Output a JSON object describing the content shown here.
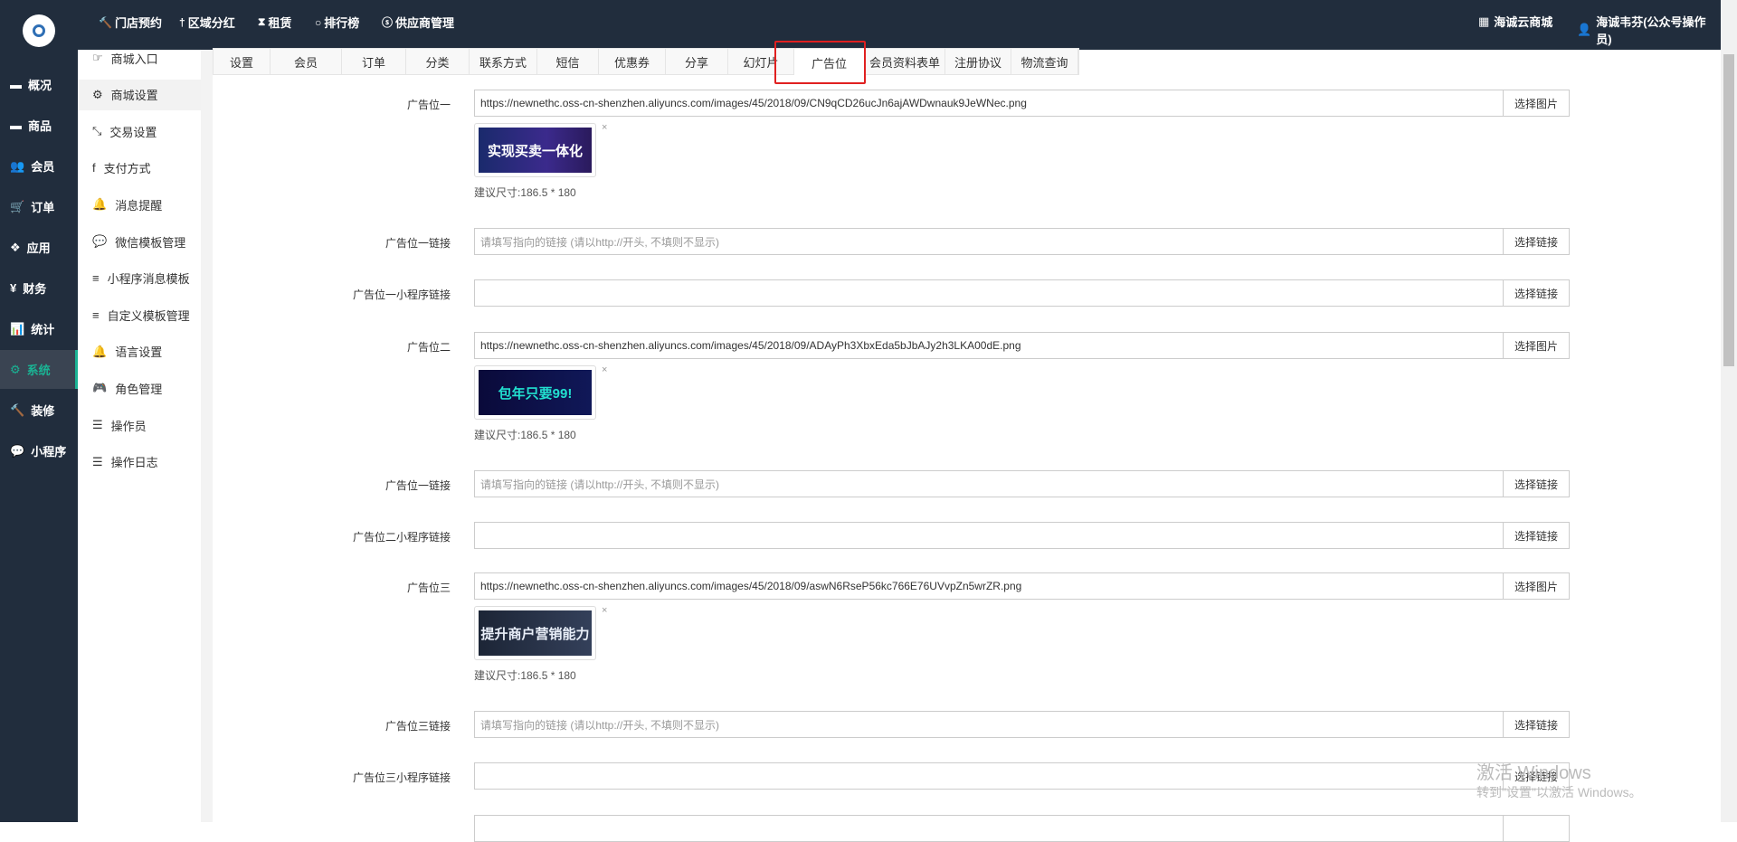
{
  "topnav": {
    "items": [
      {
        "label": "门店预约",
        "icon": "gavel-icon",
        "glyph": "🔨"
      },
      {
        "label": "区域分红",
        "icon": "key-icon",
        "glyph": "†"
      },
      {
        "label": "租赁",
        "icon": "hourglass-icon",
        "glyph": "⧗"
      },
      {
        "label": "排行榜",
        "icon": "circle-icon",
        "glyph": "○"
      },
      {
        "label": "供应商管理",
        "icon": "skype-icon",
        "glyph": "ⓢ"
      }
    ],
    "shop": "海诚云商城",
    "user": "海诚韦芬(公众号操作员)"
  },
  "sidebar": {
    "items": [
      {
        "label": "概况",
        "glyph": "▬"
      },
      {
        "label": "商品",
        "glyph": "▬"
      },
      {
        "label": "会员",
        "glyph": "👥"
      },
      {
        "label": "订单",
        "glyph": "🛒"
      },
      {
        "label": "应用",
        "glyph": "❖"
      },
      {
        "label": "财务",
        "glyph": "¥"
      },
      {
        "label": "统计",
        "glyph": "📊"
      },
      {
        "label": "系统",
        "glyph": "⚙"
      },
      {
        "label": "装修",
        "glyph": "🔨"
      },
      {
        "label": "小程序",
        "glyph": "💬"
      }
    ],
    "active": "系统"
  },
  "subnav": {
    "items": [
      {
        "label": "商城入口",
        "glyph": "☞"
      },
      {
        "label": "商城设置",
        "glyph": "⚙"
      },
      {
        "label": "交易设置",
        "glyph": "⤡"
      },
      {
        "label": "支付方式",
        "glyph": "f"
      },
      {
        "label": "消息提醒",
        "glyph": "🔔"
      },
      {
        "label": "微信模板管理",
        "glyph": "💬"
      },
      {
        "label": "小程序消息模板",
        "glyph": "≡"
      },
      {
        "label": "自定义模板管理",
        "glyph": "≡"
      },
      {
        "label": "语言设置",
        "glyph": "🔔"
      },
      {
        "label": "角色管理",
        "glyph": "🎮"
      },
      {
        "label": "操作员",
        "glyph": "☰"
      },
      {
        "label": "操作日志",
        "glyph": "☰"
      }
    ],
    "active": "商城设置"
  },
  "tabs": [
    "设置",
    "会员",
    "订单",
    "分类",
    "联系方式",
    "短信",
    "优惠券",
    "分享",
    "幻灯片",
    "广告位",
    "会员资料表单",
    "注册协议",
    "物流查询"
  ],
  "active_tab": "广告位",
  "form": {
    "select_image": "选择图片",
    "select_link": "选择链接",
    "close": "×",
    "hint": "建议尺寸:186.5 * 180",
    "link_placeholder": "请填写指向的链接 (请以http://开头, 不填则不显示)",
    "ads": [
      {
        "label": "广告位一",
        "url": "https://newnethc.oss-cn-shenzhen.aliyuncs.com/images/45/2018/09/CN9qCD26ucJn6ajAWDwnauk9JeWNec.png",
        "thumb_text": "实现买卖一体化",
        "link_label": "广告位一链接",
        "mini_label": "广告位一小程序链接"
      },
      {
        "label": "广告位二",
        "url": "https://newnethc.oss-cn-shenzhen.aliyuncs.com/images/45/2018/09/ADAyPh3XbxEda5bJbAJy2h3LKA00dE.png",
        "thumb_text": "包年只要99!",
        "link_label": "广告位一链接",
        "mini_label": "广告位二小程序链接"
      },
      {
        "label": "广告位三",
        "url": "https://newnethc.oss-cn-shenzhen.aliyuncs.com/images/45/2018/09/aswN6RseP56kc766E76UVvpZn5wrZR.png",
        "thumb_text": "提升商户营销能力",
        "link_label": "广告位三链接",
        "mini_label": "广告位三小程序链接"
      }
    ]
  },
  "watermark": {
    "title": "激活 Windows",
    "sub": "转到\"设置\"以激活 Windows。"
  }
}
